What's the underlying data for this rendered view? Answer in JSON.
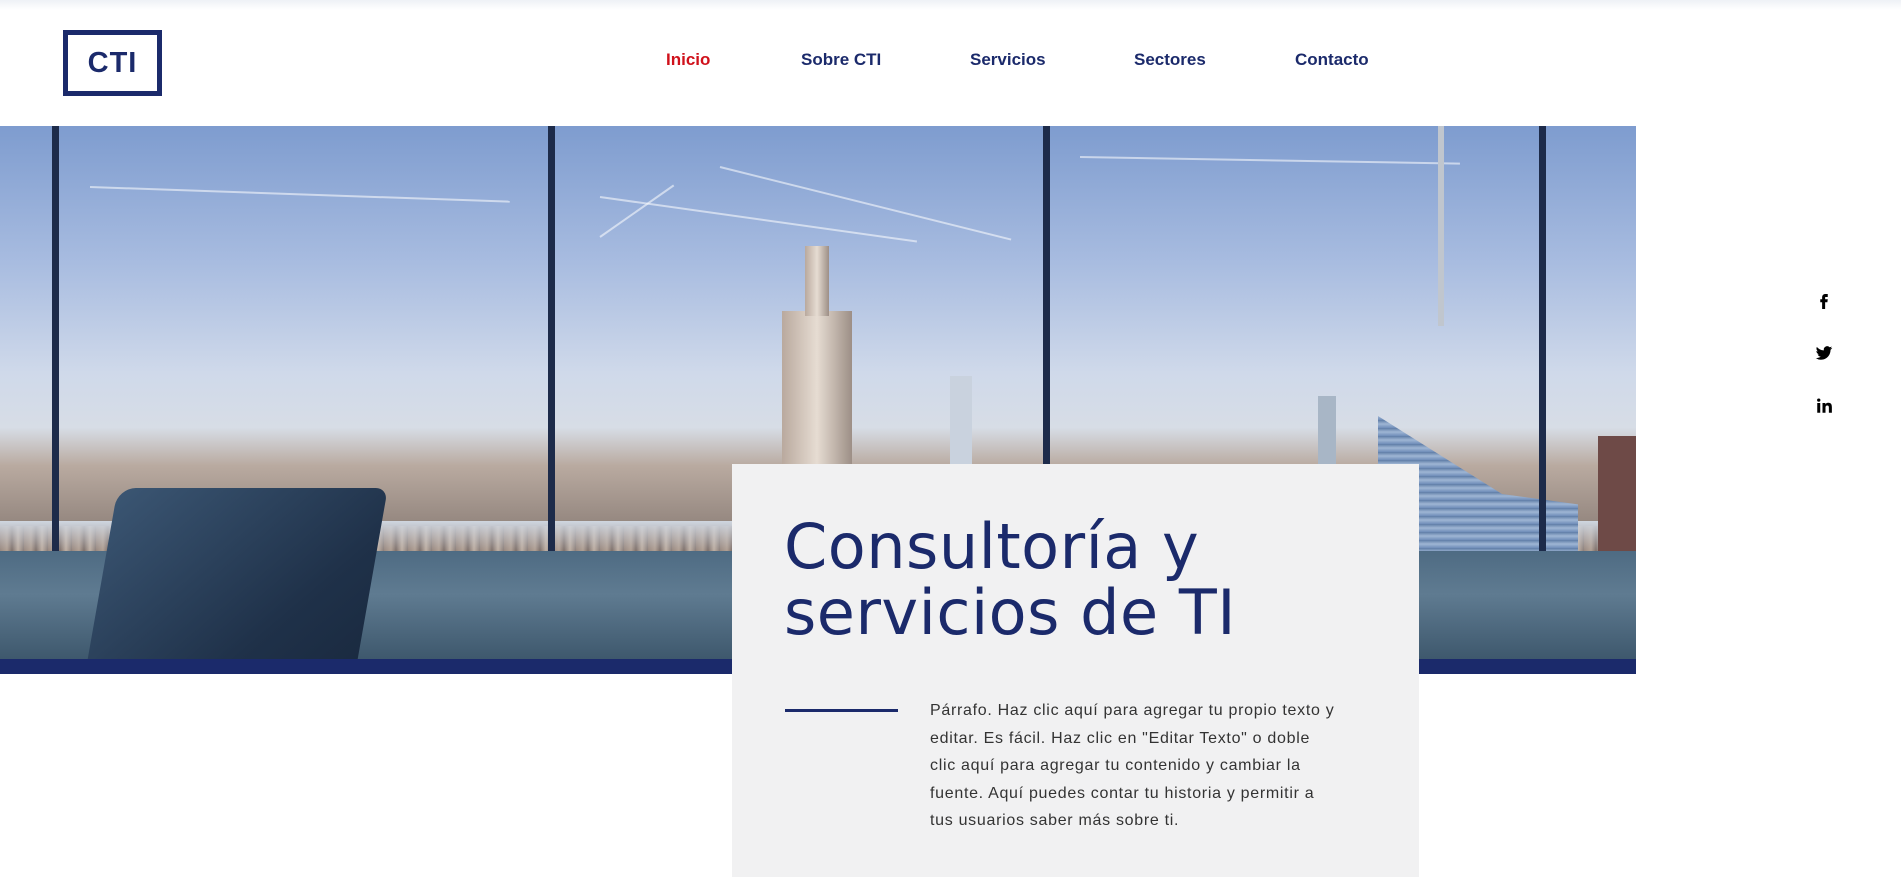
{
  "header": {
    "logo_text": "CTI",
    "nav": [
      {
        "label": "Inicio",
        "active": true
      },
      {
        "label": "Sobre CTI",
        "active": false
      },
      {
        "label": "Servicios",
        "active": false
      },
      {
        "label": "Sectores",
        "active": false
      },
      {
        "label": "Contacto",
        "active": false
      }
    ]
  },
  "hero": {
    "title": "Consultoría y servicios de TI",
    "paragraph": "Párrafo. Haz clic aquí para agregar tu propio texto y editar. Es fácil. Haz clic en \"Editar Texto\" o doble clic aquí para agregar tu contenido y cambiar la fuente. Aquí puedes contar tu historia y permitir a tus usuarios saber más sobre ti."
  },
  "social": [
    {
      "name": "facebook-icon"
    },
    {
      "name": "twitter-icon"
    },
    {
      "name": "linkedin-icon"
    }
  ],
  "colors": {
    "brand": "#1b2a6b",
    "active_nav": "#d0111b",
    "card_bg": "#f1f1f2"
  }
}
